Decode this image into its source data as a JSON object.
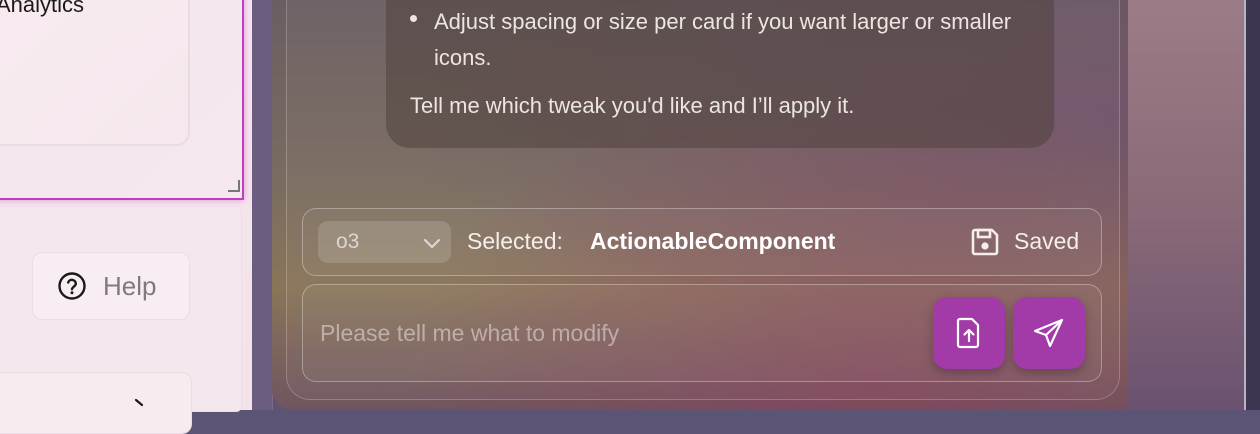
{
  "left_panel": {
    "card_title": "Analytics",
    "help_label": "Help"
  },
  "chat": {
    "bullet_text": "Adjust spacing or size per card if you want larger or smaller icons.",
    "closing_text": "Tell me which tweak you'd like and I’ll apply it."
  },
  "toolbar": {
    "model_value": "o3",
    "selected_label": "Selected:",
    "selected_value": "ActionableComponent",
    "save_label": "Saved"
  },
  "input": {
    "placeholder": "Please tell me what to modify",
    "value": ""
  },
  "colors": {
    "accent": "#a23aa8",
    "selection_border": "#c13fbf"
  },
  "icons": {
    "help": "help-circle-icon",
    "save": "floppy-disk-icon",
    "upload": "file-upload-icon",
    "send": "send-paper-plane-icon",
    "model_chevron": "chevron-down-icon",
    "next_chevron": "chevron-right-icon"
  }
}
